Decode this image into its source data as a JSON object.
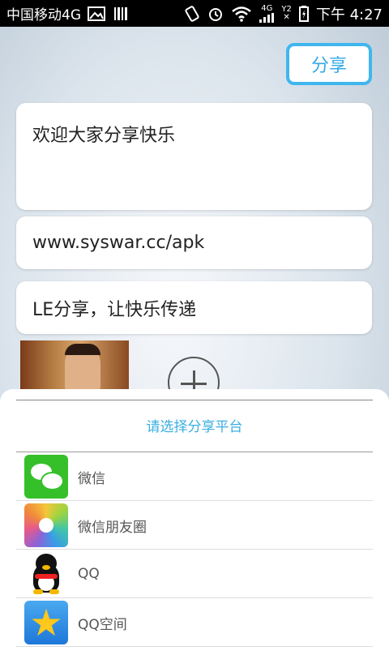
{
  "status_bar": {
    "carrier": "中国移动4G",
    "network_badge": "4G",
    "signal_badge": "Y2",
    "time": "下午 4:27",
    "icons": [
      "image-icon",
      "barcode-icon",
      "rotation-lock-icon",
      "alarm-icon",
      "wifi-icon",
      "signal-icon",
      "battery-icon"
    ]
  },
  "header": {
    "share_button": "分享"
  },
  "inputs": {
    "text": "欢迎大家分享快乐",
    "url": "www.syswar.cc/apk",
    "title": "LE分享，让快乐传递"
  },
  "share_sheet": {
    "title": "请选择分享平台",
    "items": [
      {
        "label": "微信",
        "icon": "wechat-icon"
      },
      {
        "label": "微信朋友圈",
        "icon": "wechat-moments-icon"
      },
      {
        "label": "QQ",
        "icon": "qq-icon"
      },
      {
        "label": "QQ空间",
        "icon": "qzone-icon"
      }
    ]
  },
  "colors": {
    "accent": "#3fb6ee",
    "status_bar": "#000000",
    "wechat_green": "#35c02a"
  }
}
